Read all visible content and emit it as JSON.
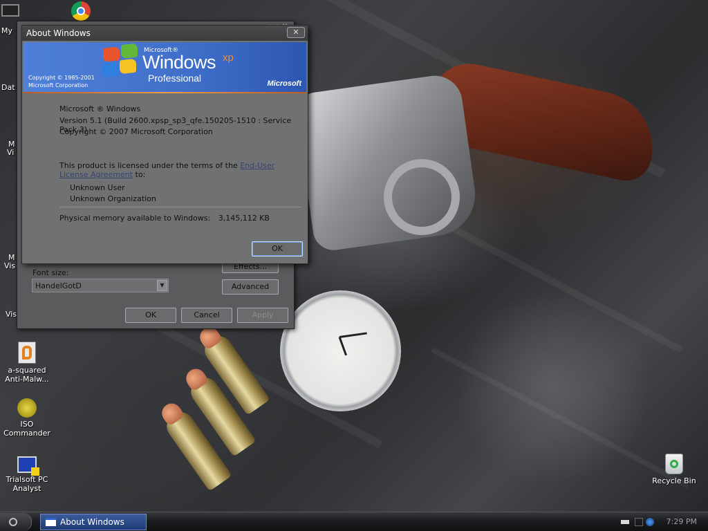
{
  "desktop": {
    "icons": [
      {
        "name": "my-computer",
        "label": "My"
      },
      {
        "name": "data",
        "label": "Dat"
      },
      {
        "name": "ms-vis-1",
        "label_line1": "M",
        "label_line2": "Vi"
      },
      {
        "name": "ms-vis-2",
        "label_line1": "M",
        "label_line2": "Vis"
      },
      {
        "name": "vis",
        "label": "Vis"
      },
      {
        "name": "a-squared",
        "label_line1": "a-squared",
        "label_line2": "Anti-Malw..."
      },
      {
        "name": "iso-commander",
        "label_line1": "ISO",
        "label_line2": "Commander"
      },
      {
        "name": "trialsoft",
        "label_line1": "Trialsoft PC",
        "label_line2": "Analyst"
      },
      {
        "name": "recycle-bin",
        "label": "Recycle Bin"
      }
    ]
  },
  "display_properties": {
    "font_size_label": "Font size:",
    "font_size_value": "HandelGotD",
    "effects_label": "Effects...",
    "advanced_label": "Advanced",
    "ok_label": "OK",
    "cancel_label": "Cancel",
    "apply_label": "Apply"
  },
  "about_dialog": {
    "title": "About Windows",
    "close_glyph": "✕",
    "banner": {
      "microsoft_small": "Microsoft®",
      "windows": "Windows",
      "xp": "xp",
      "edition": "Professional",
      "copyright_line1": "Copyright © 1985-2001",
      "copyright_line2": "Microsoft Corporation",
      "brand": "Microsoft"
    },
    "product_line": "Microsoft ® Windows",
    "version_line": "Version 5.1 (Build 2600.xpsp_sp3_qfe.150205-1510 : Service Pack 3)",
    "copyright_line": "Copyright © 2007 Microsoft Corporation",
    "license_prefix": "This product is licensed under the terms of the ",
    "license_link_1": "End-User",
    "license_link_2": "License Agreement",
    "license_suffix": " to:",
    "user": "Unknown User",
    "organization": "Unknown Organization",
    "memory_label": "Physical memory available to Windows:",
    "memory_value": "3,145,112 KB",
    "ok_label": "OK"
  },
  "taskbar": {
    "active_task": "About Windows",
    "clock": "7:29 PM"
  },
  "colors": {
    "dialog_bg": "#707173",
    "banner_blue": "#3f6ec9",
    "xp_orange": "#f48b3a",
    "taskbar_button": "#1d3a72"
  }
}
